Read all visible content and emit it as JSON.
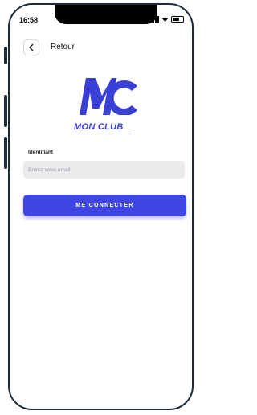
{
  "status_bar": {
    "time": "16:58",
    "icons": [
      "signal-icon",
      "wifi-icon",
      "battery-icon"
    ]
  },
  "header": {
    "back_icon": "chevron-left-icon",
    "back_label": "Retour"
  },
  "logo": {
    "monogram": "MC",
    "name": "MON CLUB",
    "brand_color": "#3a3fd6"
  },
  "form": {
    "identifier_label": "Identifiant",
    "email_value": "",
    "email_placeholder": "Entrez votre email",
    "submit_label": "ME CONNECTER",
    "accent_color": "#3f46e3"
  }
}
